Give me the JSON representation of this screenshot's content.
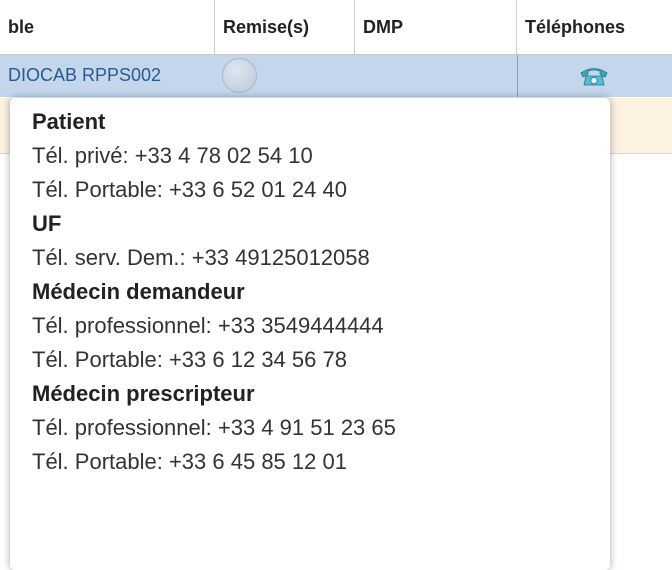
{
  "grid": {
    "headers": {
      "col1": "ble",
      "col2": "Remise(s)",
      "col3": "DMP",
      "col4": "Téléphones"
    },
    "rows": [
      {
        "col1": "DIOCAB RPPS002",
        "remise_status_icon": "circle-status-icon",
        "phone_icon": "telephone-icon"
      },
      {
        "col1": ""
      }
    ],
    "colors": {
      "selected_row": "#c3d6ec",
      "alt_row": "#fdf1e0",
      "link_text": "#2b5a8c"
    }
  },
  "tooltip": {
    "sections": [
      {
        "heading": "Patient",
        "lines": [
          "Tél. privé: +33 4 78 02 54 10",
          "Tél. Portable: +33 6 52 01 24 40"
        ]
      },
      {
        "heading": "UF",
        "lines": [
          "Tél. serv. Dem.: +33 49125012058"
        ]
      },
      {
        "heading": "Médecin demandeur",
        "lines": [
          "Tél. professionnel: +33 3549444444",
          "Tél. Portable: +33 6 12 34 56 78"
        ]
      },
      {
        "heading": "Médecin prescripteur",
        "lines": [
          "Tél. professionnel: +33 4 91 51 23 65",
          "Tél. Portable: +33 6 45 85 12 01"
        ]
      }
    ]
  }
}
